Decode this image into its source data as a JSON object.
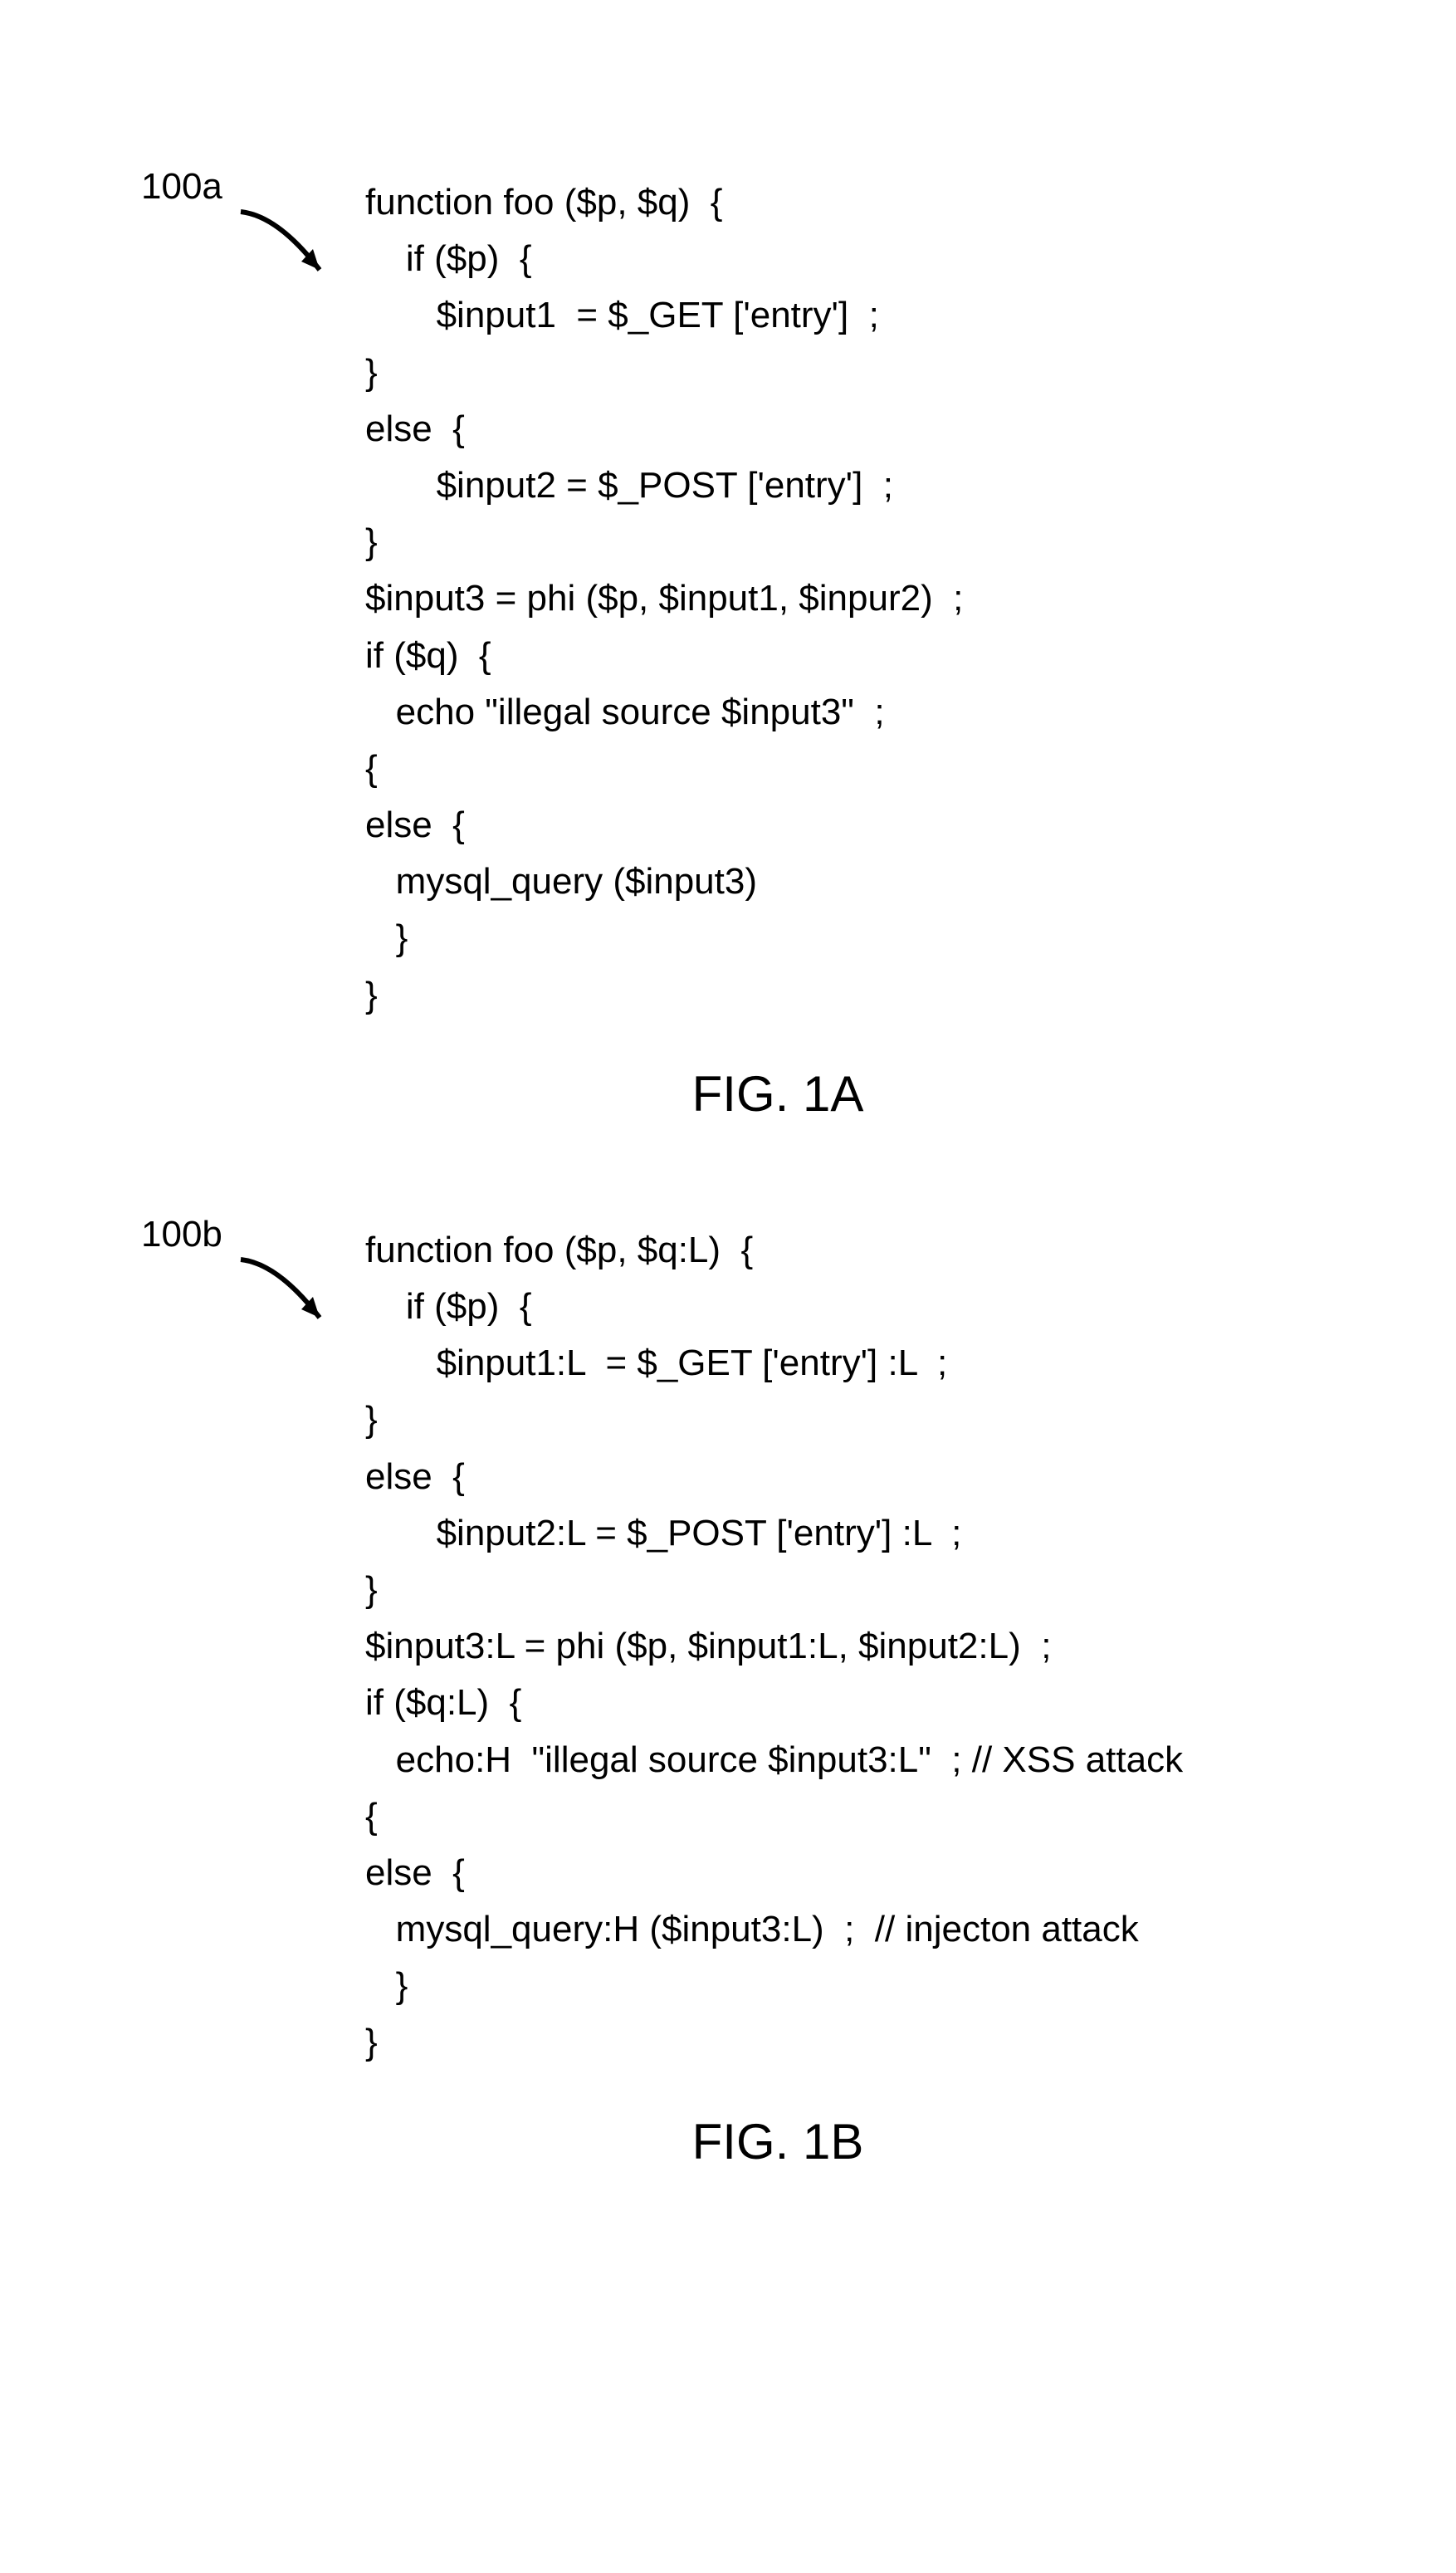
{
  "figA": {
    "ref": "100a",
    "caption": "FIG. 1A",
    "code": [
      "function foo ($p, $q)  {",
      "    if ($p)  {",
      "       $input1  = $_GET ['entry']  ;",
      "}",
      "else  {",
      "       $input2 = $_POST ['entry']  ;",
      "}",
      "$input3 = phi ($p, $input1, $inpur2)  ;",
      "if ($q)  {",
      "   echo \"illegal source $input3\"  ;",
      "{",
      "else  {",
      "   mysql_query ($input3)",
      "   }",
      "}"
    ]
  },
  "figB": {
    "ref": "100b",
    "caption": "FIG. 1B",
    "code": [
      "function foo ($p, $q:L)  {",
      "    if ($p)  {",
      "       $input1:L  = $_GET ['entry'] :L  ;",
      "}",
      "else  {",
      "       $input2:L = $_POST ['entry'] :L  ;",
      "}",
      "$input3:L = phi ($p, $input1:L, $input2:L)  ;",
      "if ($q:L)  {",
      "   echo:H  \"illegal source $input3:L\"  ; // XSS attack",
      "{",
      "else  {",
      "   mysql_query:H ($input3:L)  ;  // injecton attack",
      "   }",
      "}"
    ]
  }
}
